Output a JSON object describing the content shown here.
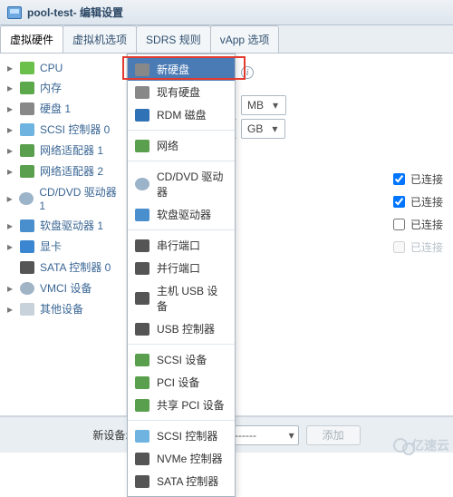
{
  "title": {
    "vm_name": "pool-test",
    "suffix": " - 编辑设置"
  },
  "tabs": [
    {
      "label": "虚拟硬件",
      "active": true
    },
    {
      "label": "虚拟机选项",
      "active": false
    },
    {
      "label": "SDRS 规则",
      "active": false
    },
    {
      "label": "vApp 选项",
      "active": false
    }
  ],
  "hardware": [
    {
      "icon": "i-cpu",
      "label": "CPU",
      "count": ""
    },
    {
      "icon": "i-mem",
      "label": "内存",
      "count": ""
    },
    {
      "icon": "i-hd",
      "label": "硬盘 1",
      "count": ""
    },
    {
      "icon": "i-scsi",
      "label": "SCSI 控制器 0",
      "count": ""
    },
    {
      "icon": "i-net",
      "label": "网络适配器 1",
      "count": ""
    },
    {
      "icon": "i-net",
      "label": "网络适配器 2",
      "count": ""
    },
    {
      "icon": "i-cd",
      "label": "CD/DVD 驱动器 1",
      "count": ""
    },
    {
      "icon": "i-fd",
      "label": "软盘驱动器 1",
      "count": ""
    },
    {
      "icon": "i-gpu",
      "label": "显卡",
      "count": ""
    },
    {
      "icon": "i-sata",
      "label": "SATA 控制器 0",
      "count": ""
    },
    {
      "icon": "i-vmci",
      "label": "VMCI 设备",
      "count": ""
    },
    {
      "icon": "i-other",
      "label": "其他设备",
      "count": ""
    }
  ],
  "menu": {
    "groups": [
      [
        {
          "icon": "i-hd",
          "label": "新硬盘",
          "selected": true
        },
        {
          "icon": "i-hd",
          "label": "现有硬盘"
        },
        {
          "icon": "i-rdm",
          "label": "RDM 磁盘"
        }
      ],
      [
        {
          "icon": "i-netdev",
          "label": "网络"
        }
      ],
      [
        {
          "icon": "i-cd",
          "label": "CD/DVD 驱动器"
        },
        {
          "icon": "i-fd",
          "label": "软盘驱动器"
        }
      ],
      [
        {
          "icon": "i-ser",
          "label": "串行端口"
        },
        {
          "icon": "i-par",
          "label": "并行端口"
        },
        {
          "icon": "i-usb",
          "label": "主机 USB 设备"
        },
        {
          "icon": "i-usbc",
          "label": "USB 控制器"
        }
      ],
      [
        {
          "icon": "i-scsid",
          "label": "SCSI 设备"
        },
        {
          "icon": "i-pci",
          "label": "PCI 设备"
        },
        {
          "icon": "i-spci",
          "label": "共享 PCI 设备"
        }
      ],
      [
        {
          "icon": "i-scsi",
          "label": "SCSI 控制器"
        },
        {
          "icon": "i-nvme",
          "label": "NVMe 控制器"
        },
        {
          "icon": "i-sata",
          "label": "SATA 控制器"
        }
      ]
    ]
  },
  "units": {
    "mb": "MB",
    "gb": "GB"
  },
  "connected": {
    "label": "已连接",
    "rows": [
      {
        "checked": true,
        "enabled": true
      },
      {
        "checked": true,
        "enabled": true
      },
      {
        "checked": false,
        "enabled": true
      },
      {
        "checked": false,
        "enabled": false
      }
    ]
  },
  "footer": {
    "label": "新设备:",
    "select_placeholder": "------- 选择 -------",
    "add_label": "添加"
  },
  "watermark": "亿速云"
}
